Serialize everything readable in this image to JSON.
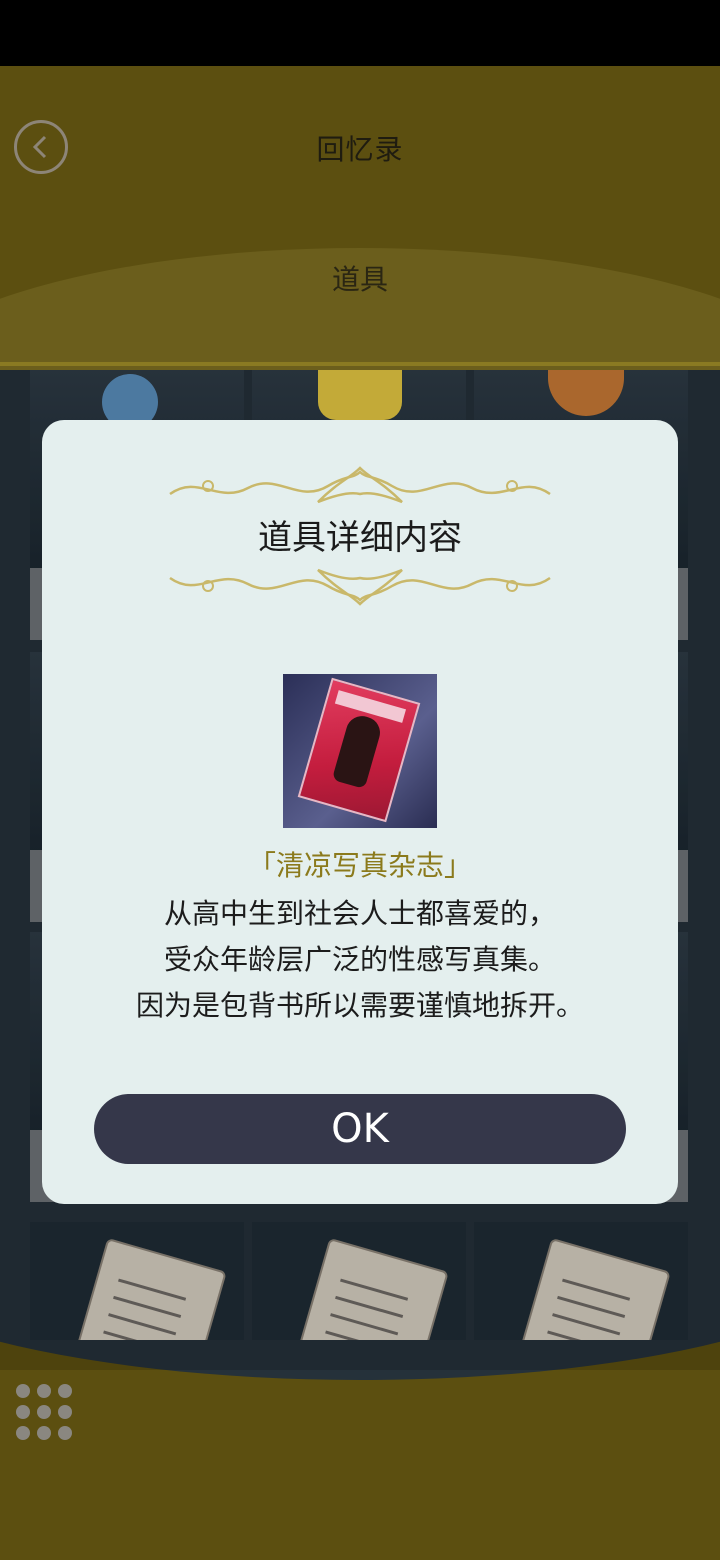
{
  "header": {
    "title": "回忆录",
    "subtitle": "道具"
  },
  "dialog": {
    "title": "道具详细内容",
    "item_name": "「清凉写真杂志」",
    "description_lines": [
      "从高中生到社会人士都喜爱的，",
      "受众年龄层广泛的性感写真集。",
      "因为是包背书所以需要谨慎地拆开。"
    ],
    "ok_label": "OK"
  },
  "icons": {
    "back": "chevron-left-icon",
    "menu": "grid-menu-icon"
  },
  "colors": {
    "header_bg": "#5c4f10",
    "accent_text": "#8b7a1c",
    "button_bg": "#35374a"
  }
}
